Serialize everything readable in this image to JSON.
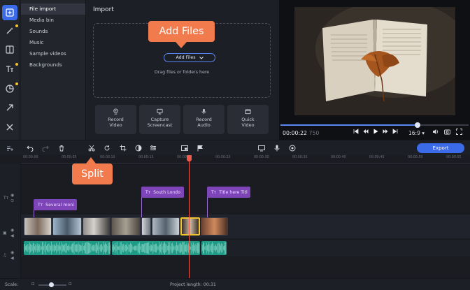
{
  "sidebar": {
    "items": [
      {
        "label": "File import",
        "active": true
      },
      {
        "label": "Media bin"
      },
      {
        "label": "Sounds"
      },
      {
        "label": "Music"
      },
      {
        "label": "Sample videos"
      },
      {
        "label": "Backgrounds"
      }
    ]
  },
  "tools": [
    "import-icon",
    "magic-wand-icon",
    "transitions-icon",
    "titles-icon",
    "stickers-icon",
    "arrow-icon",
    "tools-icon"
  ],
  "import": {
    "title": "Import",
    "add_files_select": "Add Files",
    "drop_hint": "Drag files or folders here",
    "actions": [
      {
        "line1": "Record",
        "line2": "Video",
        "icon": "webcam-icon"
      },
      {
        "line1": "Capture",
        "line2": "Screencast",
        "icon": "monitor-icon"
      },
      {
        "line1": "Record",
        "line2": "Audio",
        "icon": "microphone-icon"
      },
      {
        "line1": "Quick",
        "line2": "Video",
        "icon": "quick-video-icon"
      }
    ]
  },
  "callouts": {
    "add_files": "Add Files",
    "split": "Split"
  },
  "player": {
    "time_current": "00:00:22",
    "time_frames": "750",
    "progress": 0.73,
    "aspect_ratio": "16:9 ▾"
  },
  "timeline_toolbar": {
    "export_label": "Export"
  },
  "ruler": {
    "ticks": [
      "00:00:00",
      "00:00:05",
      "00:00:10",
      "00:00:15",
      "00:00:20",
      "00:00:25",
      "00:00:30",
      "00:00:35",
      "00:00:40",
      "00:00:45",
      "00:00:50",
      "00:00:55"
    ]
  },
  "tracks": {
    "titles": [
      {
        "label": "South Londo"
      },
      {
        "label": "Title here Titl"
      },
      {
        "label": "Several moni"
      }
    ]
  },
  "status": {
    "scale_label": "Scale:",
    "scale_value": 0.45,
    "project_length": "Project length:  00:31"
  },
  "colors": {
    "accent": "#3b6be8",
    "callout": "#f27b4e",
    "title_clip": "#7d45b8",
    "audio_clip": "#1f9a86",
    "playhead": "#f05a4a",
    "selection": "#f2c230"
  }
}
